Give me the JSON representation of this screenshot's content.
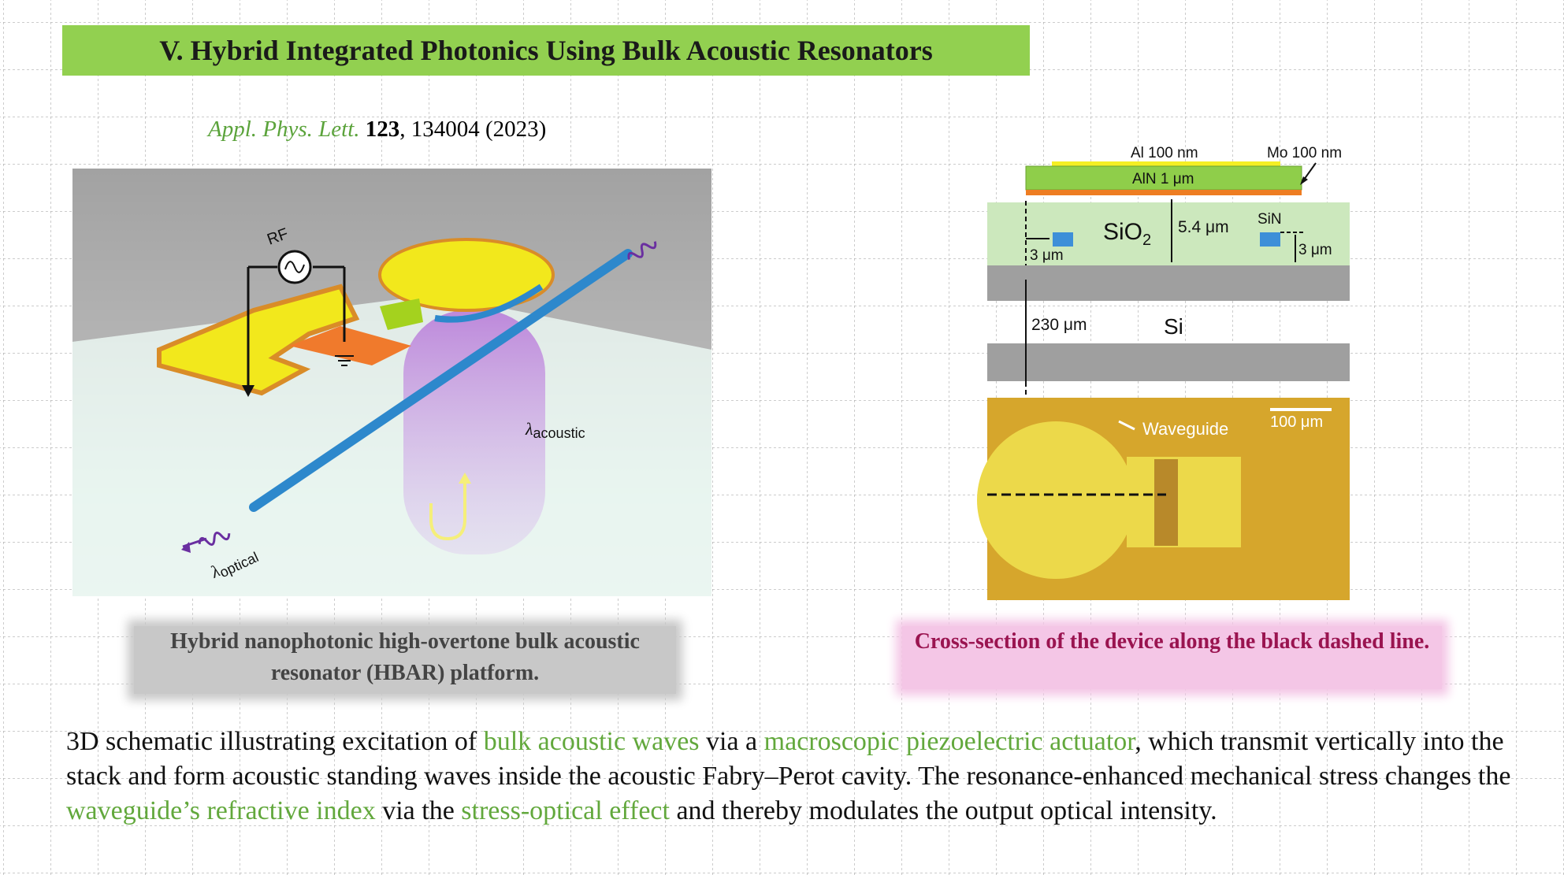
{
  "title": "V. Hybrid Integrated Photonics Using Bulk Acoustic Resonators",
  "citation": {
    "journal": "Appl. Phys. Lett.",
    "volume": "123",
    "rest": ", 134004 (2023)"
  },
  "left_figure": {
    "rf_label": "RF",
    "lambda_acoustic": "λacoustic",
    "lambda_acoustic_sym": "λ",
    "lambda_acoustic_sub": "acoustic",
    "lambda_optical_sym": "λ",
    "lambda_optical_sub": "optical"
  },
  "right_figure": {
    "al_label": "Al 100 nm",
    "mo_label": "Mo 100 nm",
    "aln_label": "AlN 1 μm",
    "sio2_label": "SiO",
    "sio2_sub": "2",
    "thickness_label": "5.4 μm",
    "sin_label": "SiN",
    "gap_label_left": "3 μm",
    "gap_label_right": "3 μm",
    "si_thickness": "230 μm",
    "si_label": "Si",
    "waveguide_label": "Waveguide",
    "scale_bar": "100 μm"
  },
  "captions": {
    "left": "Hybrid nanophotonic high-overtone bulk acoustic resonator (HBAR) platform.",
    "right": "Cross-section of the device along the black dashed line."
  },
  "body": {
    "p1": "3D schematic illustrating excitation of ",
    "h1": "bulk acoustic waves",
    "p2": " via a ",
    "h2": "macroscopic piezoelectric actuator",
    "p3": ", which transmit vertically into the stack and form acoustic standing waves inside the acoustic Fabry–Perot cavity. The resonance-enhanced mechanical stress changes the ",
    "h3": "waveguide’s refractive index",
    "p4": " via the ",
    "h4": "stress-optical effect",
    "p5": " and thereby modulates the output optical intensity."
  },
  "colors": {
    "title_bg": "#92d050",
    "highlight_green": "#62a83c",
    "caption_right_text": "#9a1450"
  }
}
